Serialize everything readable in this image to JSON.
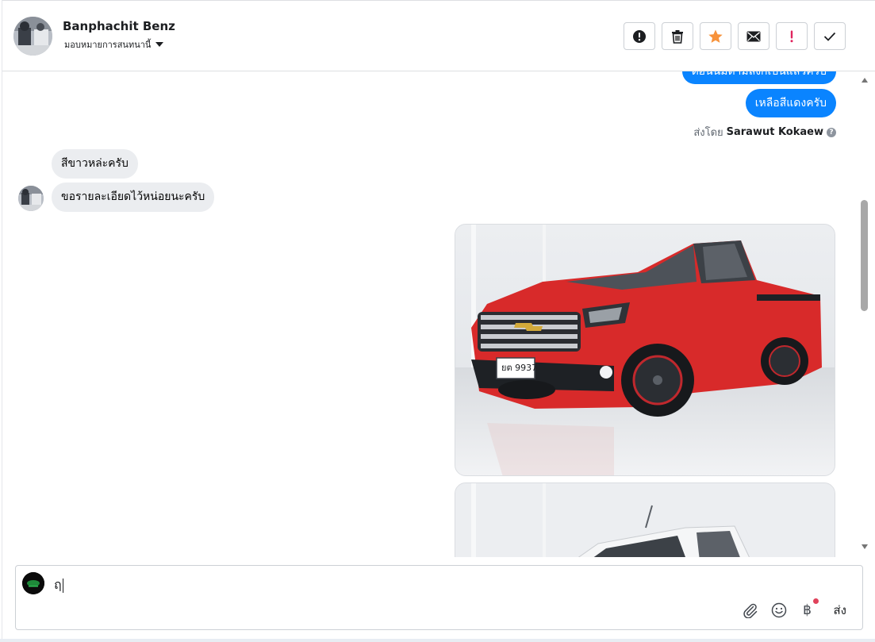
{
  "header": {
    "contact_name": "Banphachit Benz",
    "assign_label": "มอบหมายการสนทนานี้"
  },
  "actions": [
    {
      "name": "spam-alert",
      "icon": "exclamation-circle-icon"
    },
    {
      "name": "delete",
      "icon": "trash-icon"
    },
    {
      "name": "star",
      "icon": "star-icon",
      "color": "#f7923b"
    },
    {
      "name": "mark-unread",
      "icon": "envelope-icon"
    },
    {
      "name": "important",
      "icon": "exclamation-icon",
      "color": "#e0245e"
    },
    {
      "name": "done",
      "icon": "check-icon"
    }
  ],
  "messages": {
    "out_partial": "ตอนนี้มีตามลิงก์เป็นแล้วครับ",
    "out_1": "เหลือสีแดงครับ",
    "sent_by_prefix": "ส่งโดย",
    "sent_by_name": "Sarawut Kokaew",
    "in_1": "สีขาวหล่ะครับ",
    "in_2": "ขอรายละเอียดไว้หน่อยนะครับ"
  },
  "images": {
    "car_1": {
      "color": "red",
      "plate": "ยต 9937"
    },
    "car_2": {
      "color": "white"
    }
  },
  "composer": {
    "draft_text": "ฤ",
    "send_label": "ส่ง",
    "baht_symbol": "฿"
  },
  "colors": {
    "accent": "#0a84ff",
    "incoming_bubble": "#ebedf0",
    "star": "#f7923b",
    "important": "#e0245e"
  }
}
